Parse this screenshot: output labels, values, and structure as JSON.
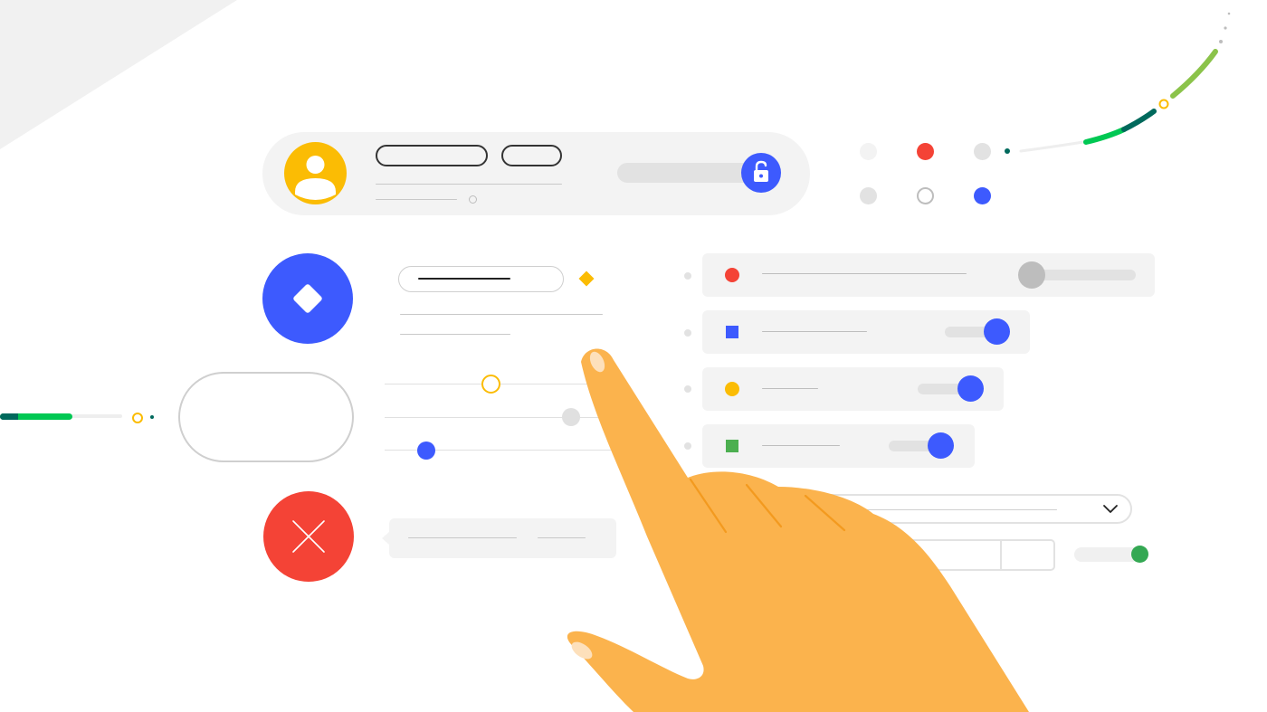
{
  "colors": {
    "blue": "#3d5afe",
    "red": "#f44336",
    "yellow": "#fbbc04",
    "green": "#34a853",
    "green_bright": "#00c853",
    "green_light": "#8bc34a",
    "teal": "#00695c",
    "hand": "#fbb34d",
    "surface": "#f3f3f3"
  },
  "icons": {
    "avatar": "person-icon",
    "lock": "unlock-icon",
    "fab_primary": "diamond-icon",
    "fab_danger": "close-icon",
    "dropdown": "chevron-down-icon",
    "hand": "pointing-hand-illustration"
  },
  "controls": {
    "pin_toggle": "on",
    "row_toggles": [
      "off",
      "on",
      "on",
      "on"
    ],
    "bottom_toggle": "on",
    "sliders": [
      0.5,
      0.87,
      0.2
    ]
  }
}
